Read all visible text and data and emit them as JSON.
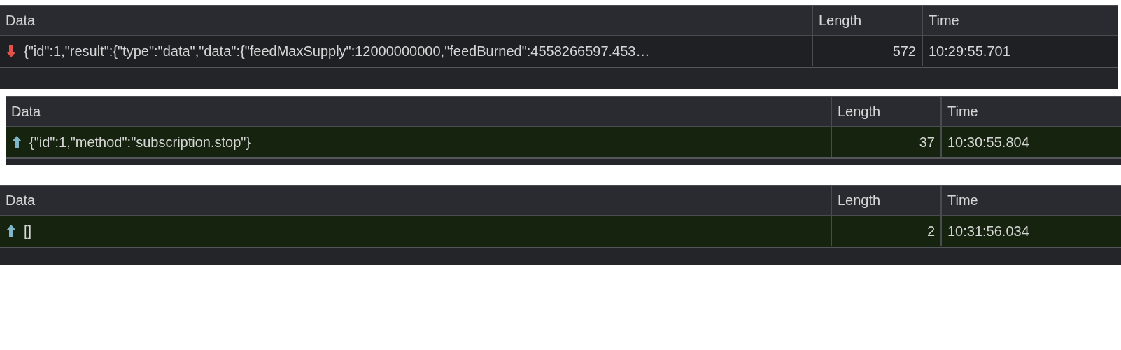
{
  "panels": [
    {
      "columns": [
        "Data",
        "Length",
        "Time"
      ],
      "rows": [
        {
          "kind": "received",
          "data": "{\"id\":1,\"result\":{\"type\":\"data\",\"data\":{\"feedMaxSupply\":12000000000,\"feedBurned\":4558266597.453…",
          "length": "572",
          "time": "10:29:55.701"
        }
      ]
    },
    {
      "columns": [
        "Data",
        "Length",
        "Time"
      ],
      "rows": [
        {
          "kind": "sent",
          "data": "{\"id\":1,\"method\":\"subscription.stop\"}",
          "length": "37",
          "time": "10:30:55.804"
        }
      ]
    },
    {
      "columns": [
        "Data",
        "Length",
        "Time"
      ],
      "rows": [
        {
          "kind": "sent",
          "data": "[]",
          "length": "2",
          "time": "10:31:56.034"
        }
      ]
    }
  ]
}
